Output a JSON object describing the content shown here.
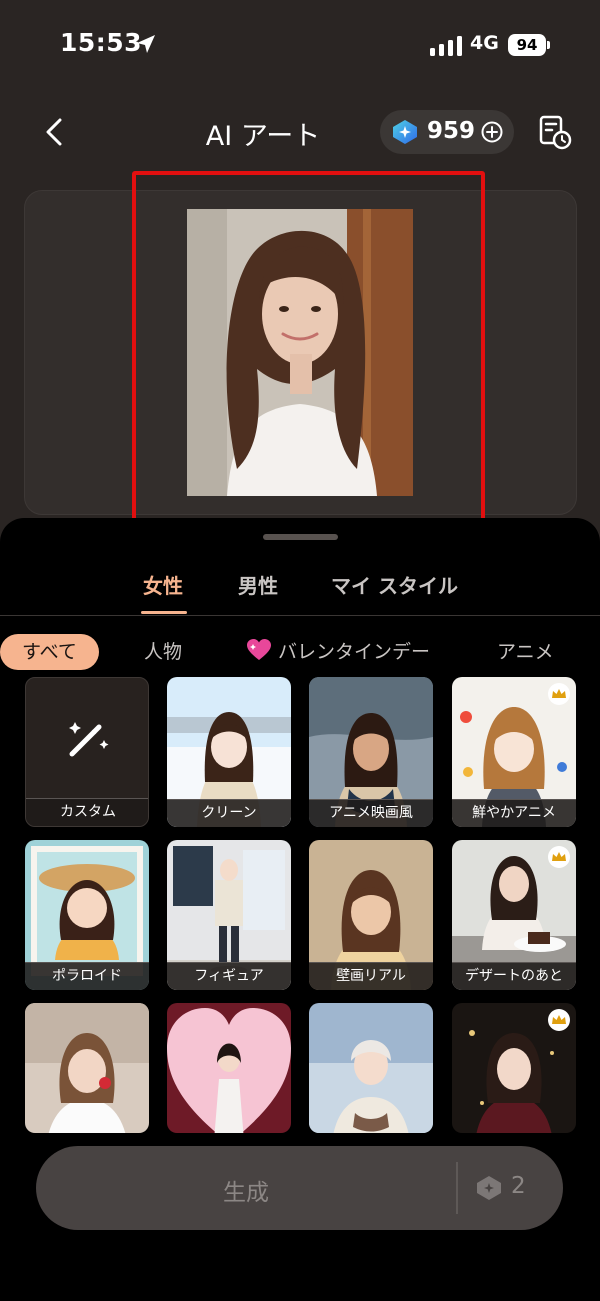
{
  "status_bar": {
    "time": "15:53",
    "network": "4G",
    "battery": "94"
  },
  "header": {
    "title": "AI アート",
    "credits": "959"
  },
  "gender_tabs": [
    {
      "label": "女性",
      "active": true
    },
    {
      "label": "男性",
      "active": false
    },
    {
      "label": "マイ スタイル",
      "active": false
    }
  ],
  "category_chips": [
    {
      "label": "すべて",
      "active": true
    },
    {
      "label": "人物",
      "active": false
    },
    {
      "label": "バレンタインデー",
      "active": false,
      "icon": "sparkling-heart-icon"
    },
    {
      "label": "アニメ",
      "active": false
    }
  ],
  "styles": [
    {
      "label": "カスタム",
      "icon": "magic-wand-icon",
      "premium": false
    },
    {
      "label": "クリーン",
      "premium": false
    },
    {
      "label": "アニメ映画風",
      "premium": false
    },
    {
      "label": "鮮やかアニメ",
      "premium": true
    },
    {
      "label": "ポラロイド",
      "premium": false
    },
    {
      "label": "フィギュア",
      "premium": false
    },
    {
      "label": "壁画リアル",
      "premium": false
    },
    {
      "label": "デザートのあと",
      "premium": true
    },
    {
      "label": "",
      "premium": false
    },
    {
      "label": "",
      "premium": false
    },
    {
      "label": "",
      "premium": false
    },
    {
      "label": "",
      "premium": true
    }
  ],
  "generate": {
    "label": "生成",
    "cost": "2"
  },
  "colors": {
    "accent": "#f6b48f",
    "highlight": "#e20f0f",
    "background": "#000000",
    "panel": "#2a2523"
  }
}
